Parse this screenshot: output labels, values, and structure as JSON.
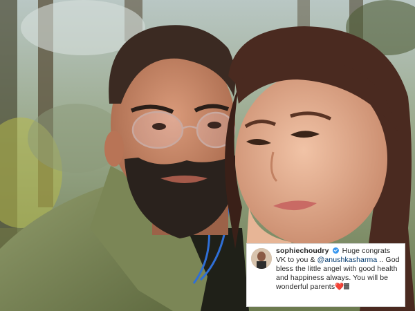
{
  "photo": {
    "description_icon": "couple-selfie-photo"
  },
  "comment": {
    "username": "sophiechoudry",
    "verified_icon": "verified-badge-icon",
    "text_before_mention": "Huge congrats VK to you & ",
    "mention": "@anushkasharma",
    "text_after_mention": " .. God bless the little angel with good health and happiness always. You will be wonderful parents",
    "heart_glyph": "❤️",
    "heart_icon": "red-heart-emoji",
    "flag_icon": "flag-emoji",
    "colors": {
      "verified": "#3897f0",
      "mention": "#00376b",
      "text": "#262626"
    }
  }
}
